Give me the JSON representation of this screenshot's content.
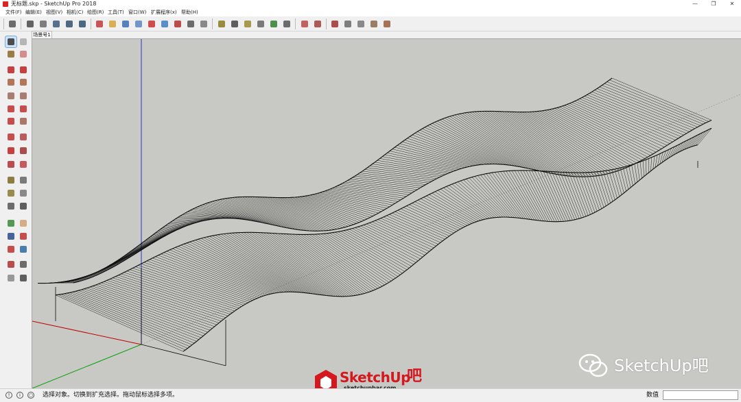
{
  "window": {
    "title": "无标题.skp - SketchUp Pro 2018",
    "minimize_glyph": "—",
    "restore_glyph": "❐",
    "close_glyph": "✕"
  },
  "menu": {
    "items": [
      "文件(F)",
      "编辑(E)",
      "视图(V)",
      "相机(C)",
      "绘图(R)",
      "工具(T)",
      "窗口(W)",
      "扩展程序(x)",
      "帮助(H)"
    ]
  },
  "toolbar": {
    "icons": [
      "select-icon",
      "component-icon",
      "eraser-icon",
      "paint-icon",
      "orbit-icon",
      "pan-icon",
      "zoom-icon",
      "zoom-window-icon",
      "zoom-extents-icon",
      "walk-icon",
      "look-around-icon",
      "position-camera-icon",
      "footprints-icon",
      "tape-measure-icon",
      "protractor-icon",
      "dimension-icon",
      "text-icon",
      "axes-icon",
      "section-icon",
      "sandbox-from-contours-icon",
      "sandbox-from-scratch-icon",
      "smoove-icon",
      "stamp-icon",
      "drape-icon",
      "add-detail-icon",
      "flip-edge-icon"
    ]
  },
  "scene": {
    "tab_label": "场景号1"
  },
  "palette": {
    "tools": [
      "select-icon",
      "make-component-icon",
      "paint-bucket-icon",
      "eraser-icon",
      "line-icon",
      "freehand-icon",
      "rectangle-icon",
      "rotated-rectangle-icon",
      "circle-icon",
      "polygon-icon",
      "arc-icon",
      "pie-icon",
      "three-point-arc-icon",
      "two-point-arc-icon",
      "push-pull-icon",
      "follow-me-icon",
      "rotate-icon",
      "offset-icon",
      "scale-icon",
      "move-icon",
      "tape-measure-icon",
      "dimension-icon",
      "protractor-icon",
      "text-icon",
      "axes-icon",
      "3d-text-icon",
      "orbit-icon",
      "pan-icon",
      "zoom-icon",
      "zoom-window-icon",
      "zoom-extents-icon",
      "previous-view-icon",
      "position-camera-icon",
      "look-around-icon",
      "walk-icon",
      "section-plane-icon"
    ]
  },
  "colors": {
    "viewport_bg": "#c8c8c4",
    "accent_red": "#d4181e",
    "wireframe": "#0a0a0a",
    "axis_red": "#c00000",
    "axis_green": "#00a000",
    "axis_blue": "#3030c0"
  },
  "watermark": {
    "brand": "SketchUp",
    "brand_suffix": "吧",
    "url": "sketchupbar.com",
    "wechat_label": "SketchUp吧"
  },
  "status": {
    "message": "选择对象。切换到扩充选择。拖动鼠标选择多项。",
    "measurements_label": "数值",
    "measurements_value": ""
  }
}
